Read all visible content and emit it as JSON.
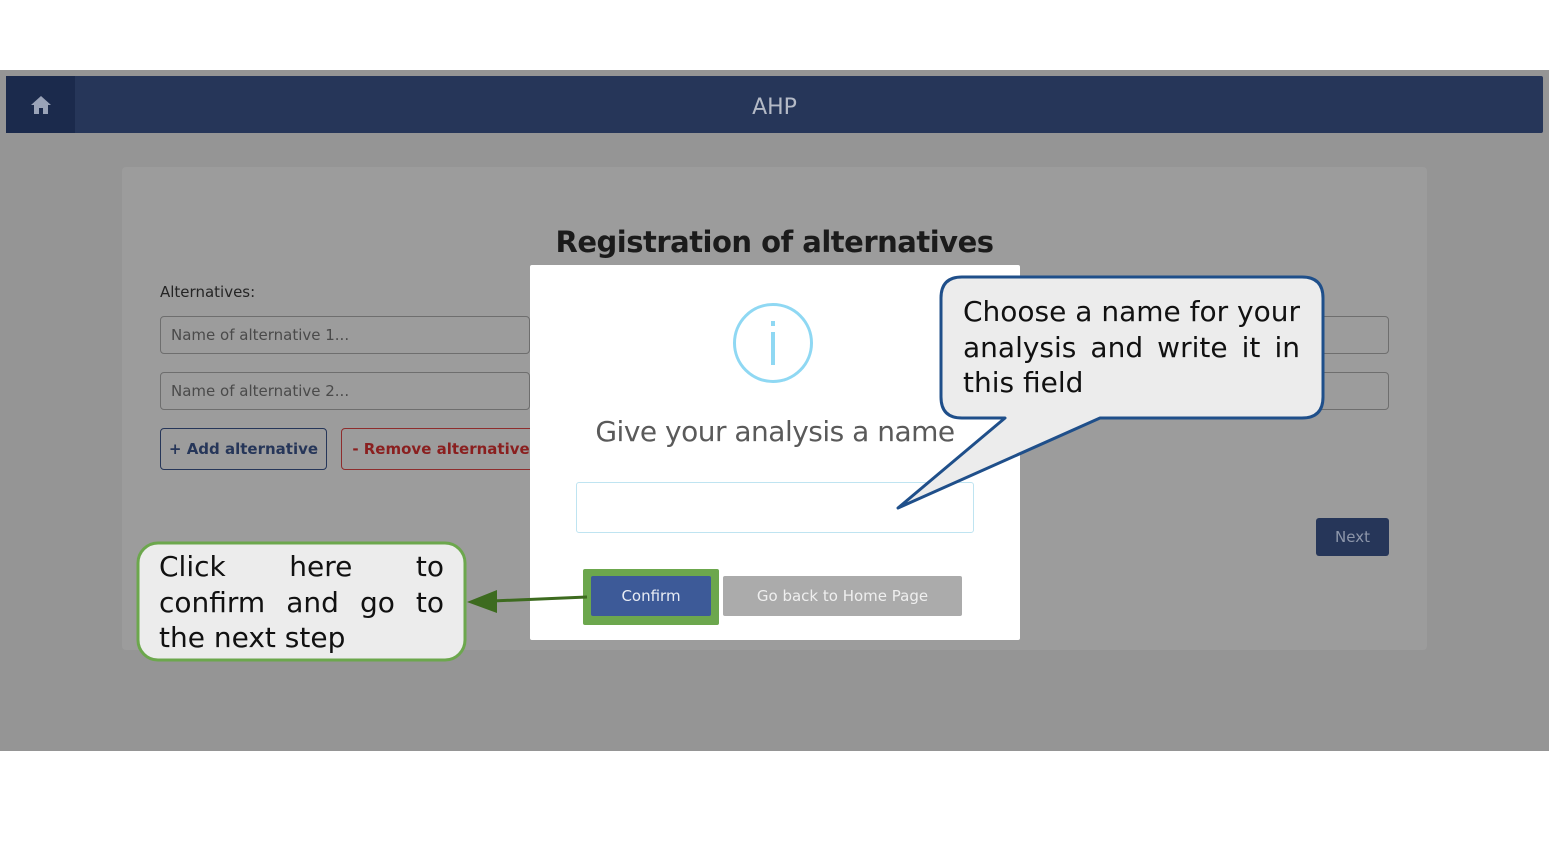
{
  "app": {
    "title": "AHP",
    "home_icon": "home-icon"
  },
  "page": {
    "title": "Registration of alternatives",
    "alternatives_label": "Alternatives:",
    "inputs": [
      {
        "placeholder": "Name of alternative 1..."
      },
      {
        "placeholder": "Name of alternative 2..."
      }
    ],
    "add_label": "+ Add alternative",
    "remove_label": "- Remove alternative",
    "next_label": "Next"
  },
  "modal": {
    "icon": "info-icon",
    "title": "Give your analysis a name",
    "input_value": "",
    "confirm_label": "Confirm",
    "home_label": "Go back to Home Page"
  },
  "annotations": {
    "name_hint": "Choose a name for your analysis and write it in this field",
    "confirm_hint": "Click here to confirm and go to the next step"
  },
  "colors": {
    "navbar": "#263659",
    "overlay": "#959595",
    "confirm": "#3d5a98",
    "highlight_green": "#6ca74d",
    "callout_blue_border": "#1f4f8a",
    "callout_green_border": "#6ca74d",
    "info_icon": "#8fd8f3"
  }
}
